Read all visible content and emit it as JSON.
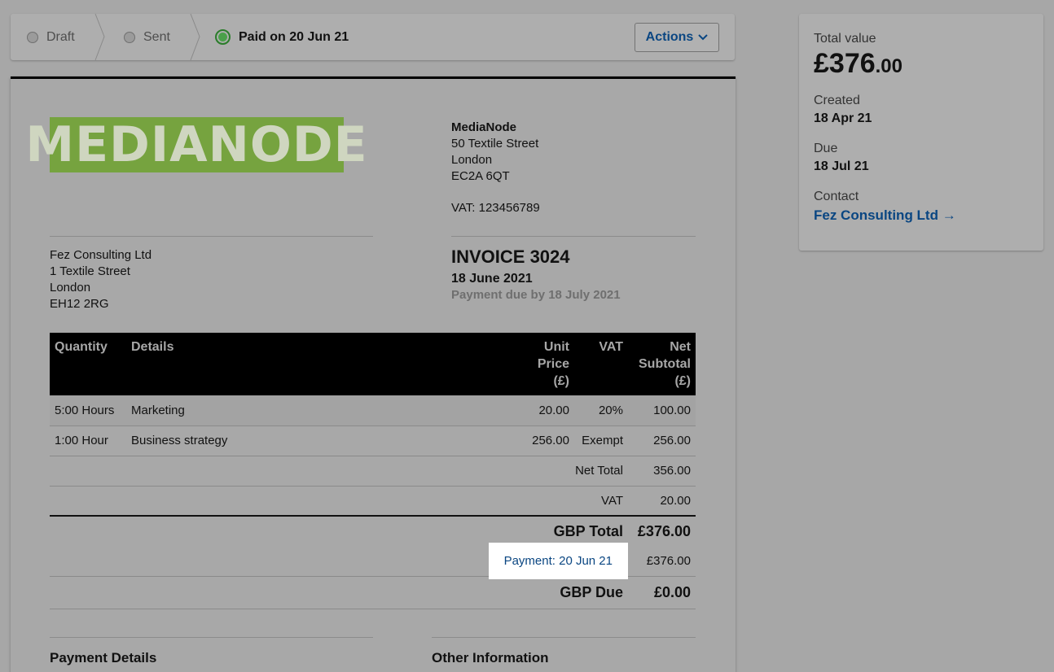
{
  "status_bar": {
    "steps": [
      {
        "label": "Draft",
        "state": "inactive"
      },
      {
        "label": "Sent",
        "state": "inactive"
      },
      {
        "label": "Paid on 20 Jun 21",
        "state": "active"
      }
    ],
    "actions_label": "Actions"
  },
  "invoice": {
    "logo_text": "MEDIANODE",
    "from": {
      "name": "MediaNode",
      "line1": "50 Textile Street",
      "line2": "London",
      "line3": "EC2A 6QT",
      "vat": "VAT: 123456789"
    },
    "to": {
      "name": "Fez Consulting Ltd",
      "line1": "1 Textile Street",
      "line2": "London",
      "line3": "EH12 2RG"
    },
    "title": "INVOICE 3024",
    "date": "18 June 2021",
    "payment_due": "Payment due by 18 July 2021",
    "columns": {
      "quantity": "Quantity",
      "details": "Details",
      "unit_price_1": "Unit",
      "unit_price_2": "Price",
      "unit_price_3": "(£)",
      "vat": "VAT",
      "net_1": "Net",
      "net_2": "Subtotal",
      "net_3": "(£)"
    },
    "lines": [
      {
        "quantity": "5:00 Hours",
        "details": "Marketing",
        "unit_price": "20.00",
        "vat": "20%",
        "net": "100.00"
      },
      {
        "quantity": "1:00 Hour",
        "details": "Business strategy",
        "unit_price": "256.00",
        "vat": "Exempt",
        "net": "256.00"
      }
    ],
    "totals": {
      "net_total_label": "Net Total",
      "net_total": "356.00",
      "vat_label": "VAT",
      "vat": "20.00",
      "gbp_total_label": "GBP Total",
      "gbp_total": "£376.00",
      "payment_label": "Payment: 20 Jun 21",
      "payment_amount": "£376.00",
      "gbp_due_label": "GBP Due",
      "gbp_due": "£0.00"
    },
    "payment_details_heading": "Payment Details",
    "other_information_heading": "Other Information"
  },
  "summary": {
    "total_value_label": "Total value",
    "total_value_main": "£376",
    "total_value_decimal": ".00",
    "created_label": "Created",
    "created": "18 Apr 21",
    "due_label": "Due",
    "due": "18 Jul 21",
    "contact_label": "Contact",
    "contact": "Fez Consulting Ltd →"
  }
}
